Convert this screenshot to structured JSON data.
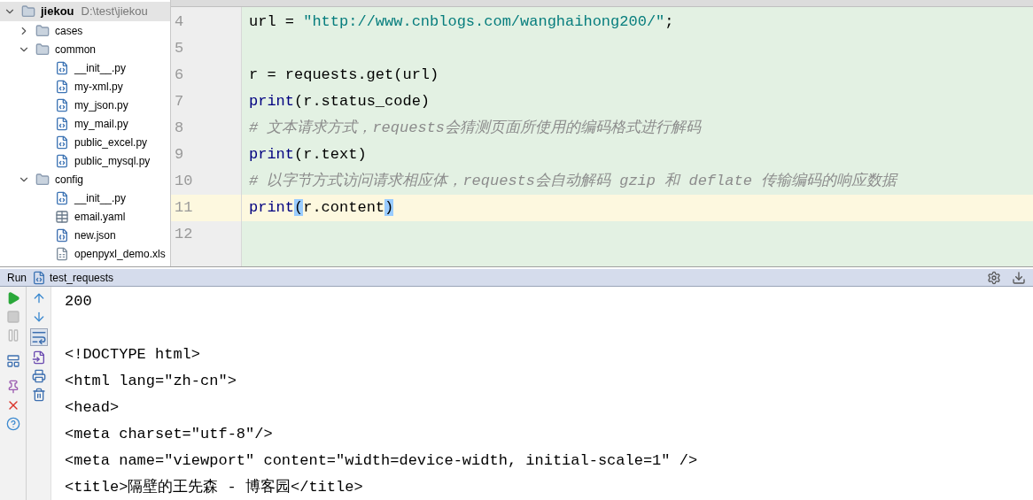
{
  "project_tree": {
    "root": {
      "name": "jiekou",
      "path": "D:\\test\\jiekou",
      "expanded": true
    },
    "items": [
      {
        "name": "cases",
        "kind": "folder",
        "expanded": false
      },
      {
        "name": "common",
        "kind": "folder",
        "expanded": true,
        "children": [
          {
            "name": "__init__.py",
            "kind": "python"
          },
          {
            "name": "my-xml.py",
            "kind": "python"
          },
          {
            "name": "my_json.py",
            "kind": "python"
          },
          {
            "name": "my_mail.py",
            "kind": "python"
          },
          {
            "name": "public_excel.py",
            "kind": "python"
          },
          {
            "name": "public_mysql.py",
            "kind": "python"
          }
        ]
      },
      {
        "name": "config",
        "kind": "folder",
        "expanded": true,
        "children": [
          {
            "name": "__init__.py",
            "kind": "python"
          },
          {
            "name": "email.yaml",
            "kind": "yaml"
          },
          {
            "name": "new.json",
            "kind": "json"
          },
          {
            "name": "openpyxl_demo.xls",
            "kind": "xls"
          }
        ]
      }
    ]
  },
  "editor": {
    "lines": [
      {
        "number": "4",
        "current": false,
        "tokens": [
          {
            "text": "url = ",
            "kind": "plain"
          },
          {
            "text": "\"http://www.cnblogs.com/wanghaihong200/\"",
            "kind": "string"
          },
          {
            "text": ";",
            "kind": "plain"
          }
        ]
      },
      {
        "number": "5",
        "current": false
      },
      {
        "number": "6",
        "current": false,
        "tokens": [
          {
            "text": "r = requests.get(url)",
            "kind": "plain"
          }
        ]
      },
      {
        "number": "7",
        "current": false,
        "tokens": [
          {
            "text": "print",
            "kind": "builtin"
          },
          {
            "text": "(r.status_code)",
            "kind": "plain"
          }
        ]
      },
      {
        "number": "8",
        "current": false,
        "tokens": [
          {
            "text": "# 文本请求方式，requests会猜测页面所使用的编码格式进行解码",
            "kind": "comment"
          }
        ]
      },
      {
        "number": "9",
        "current": false,
        "tokens": [
          {
            "text": "print",
            "kind": "builtin"
          },
          {
            "text": "(r.text)",
            "kind": "plain"
          }
        ]
      },
      {
        "number": "10",
        "current": false,
        "tokens": [
          {
            "text": "# 以字节方式访问请求相应体，requests会自动解码 gzip 和 deflate 传输编码的响应数据",
            "kind": "comment"
          }
        ]
      },
      {
        "number": "11",
        "current": true,
        "tokens": [
          {
            "text": "print",
            "kind": "builtin"
          },
          {
            "text": "(",
            "kind": "brace_match"
          },
          {
            "text": "r.content",
            "kind": "plain"
          },
          {
            "text": ")",
            "kind": "brace_match"
          }
        ]
      },
      {
        "number": "12",
        "current": false
      }
    ]
  },
  "run_panel": {
    "label": "Run",
    "config_name": "test_requests",
    "output_blocks": [
      [
        "200"
      ],
      [
        "<!DOCTYPE html>",
        "<html lang=\"zh-cn\">",
        "<head>",
        "<meta charset=\"utf-8\"/>",
        "<meta name=\"viewport\" content=\"width=device-width, initial-scale=1\" />",
        "<title>隔壁的王先森 - 博客园</title>"
      ]
    ]
  }
}
